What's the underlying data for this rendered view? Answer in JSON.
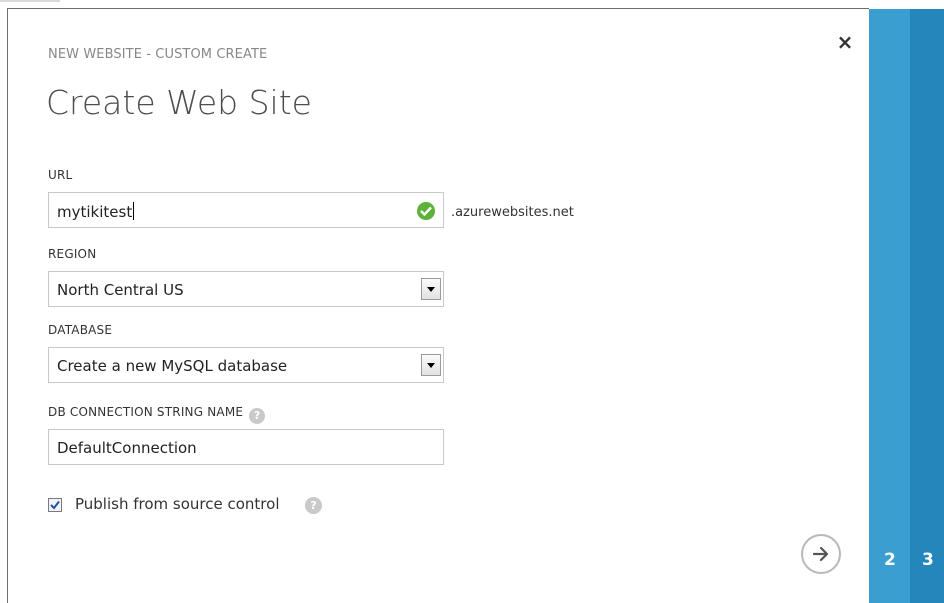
{
  "dialog": {
    "subtitle": "NEW WEBSITE - CUSTOM CREATE",
    "title": "Create Web Site",
    "close_glyph": "×"
  },
  "url": {
    "label": "URL",
    "value": "mytikitest",
    "suffix": ".azurewebsites.net",
    "status_icon": "check-circle-icon",
    "status_color": "#5eb238"
  },
  "region": {
    "label": "REGION",
    "selected": "North Central US"
  },
  "database": {
    "label": "DATABASE",
    "selected": "Create a new MySQL database"
  },
  "connection": {
    "label": "DB CONNECTION STRING NAME",
    "value": "DefaultConnection",
    "help_glyph": "?"
  },
  "publish": {
    "label": "Publish from source control",
    "checked": true,
    "help_glyph": "?"
  },
  "wizard": {
    "next_icon": "arrow-right-icon",
    "steps": [
      "2",
      "3"
    ],
    "step_colors": [
      "#3a9fd0",
      "#2586bb"
    ]
  }
}
